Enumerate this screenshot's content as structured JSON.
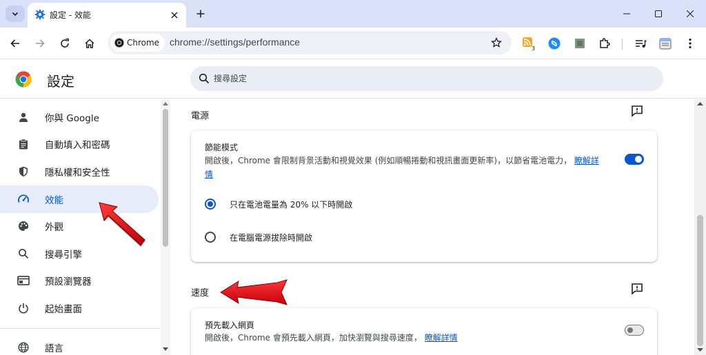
{
  "browser": {
    "tab_title": "設定 - 效能",
    "origin_chip": "Chrome",
    "url": "chrome://settings/performance",
    "extension_badge": "3"
  },
  "settings": {
    "title": "設定",
    "search_placeholder": "搜尋設定"
  },
  "sidebar": {
    "items": [
      {
        "label": "你與 Google",
        "icon": "person-icon"
      },
      {
        "label": "自動填入和密碼",
        "icon": "clipboard-icon"
      },
      {
        "label": "隱私權和安全性",
        "icon": "shield-icon"
      },
      {
        "label": "效能",
        "icon": "speedometer-icon",
        "active": true
      },
      {
        "label": "外觀",
        "icon": "palette-icon"
      },
      {
        "label": "搜尋引擎",
        "icon": "search-icon"
      },
      {
        "label": "預設瀏覽器",
        "icon": "browser-window-icon"
      },
      {
        "label": "起始畫面",
        "icon": "power-icon"
      },
      {
        "label": "語言",
        "icon": "globe-icon"
      }
    ]
  },
  "power": {
    "section_title": "電源",
    "energy_saver": {
      "title": "節能模式",
      "description": "開啟後，Chrome 會限制背景活動和視覺效果 (例如順暢捲動和視訊畫面更新率)，以節省電池電力，",
      "link": "瞭解詳情",
      "enabled": true
    },
    "options": [
      {
        "label": "只在電池電量為 20% 以下時開啟",
        "checked": true
      },
      {
        "label": "在電腦電源拔除時開啟",
        "checked": false
      }
    ]
  },
  "speed": {
    "section_title": "速度",
    "preload": {
      "title": "預先載入網頁",
      "description": "開啟後，Chrome 會預先載入網頁，加快瀏覽與搜尋速度，",
      "link": "瞭解詳情",
      "enabled": false
    }
  },
  "colors": {
    "accent": "#0b57d0",
    "annotation_arrow": "#e8141b"
  }
}
